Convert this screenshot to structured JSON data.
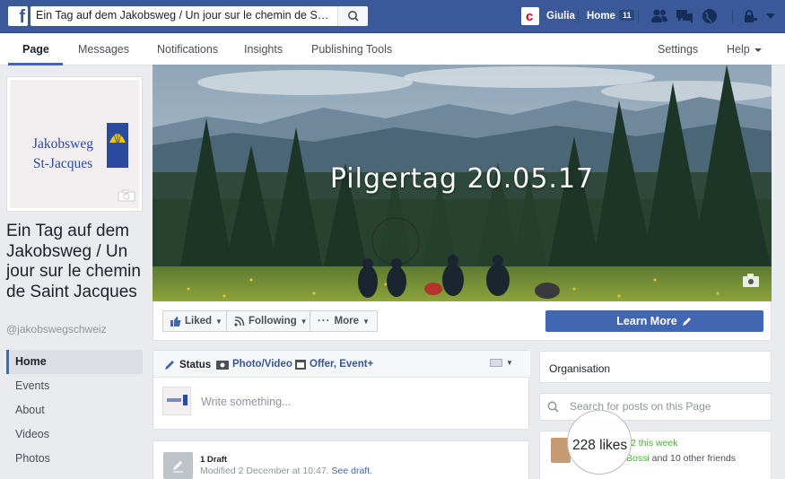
{
  "topbar": {
    "search_value": "Ein Tag auf dem Jakobsweg  / Un jour sur le chemin de Saint Jacques",
    "user_name": "Giulia",
    "home_label": "Home",
    "home_count": "11"
  },
  "pagenav": {
    "items": [
      "Page",
      "Messages",
      "Notifications",
      "Insights",
      "Publishing Tools"
    ],
    "settings": "Settings",
    "help": "Help"
  },
  "page": {
    "logo_line1": "Jakobsweg",
    "logo_line2": "St-Jacques",
    "name": "Ein Tag auf dem Jakobsweg / Un jour sur le chemin de Saint Jacques",
    "handle": "@jakobswegschweiz",
    "sidebar": [
      "Home",
      "Events",
      "About",
      "Videos",
      "Photos"
    ]
  },
  "cover": {
    "title": "Pilgertag 20.05.17",
    "liked": "Liked",
    "following": "Following",
    "more": "More",
    "learn_more": "Learn More"
  },
  "composer": {
    "status": "Status",
    "photo_video": "Photo/Video",
    "offer_event": "Offer, Event+",
    "placeholder": "Write something..."
  },
  "draft": {
    "title": "1 Draft",
    "modified": "Modified 2 December at 10:47.",
    "see_draft": "See draft."
  },
  "right": {
    "organisation": "Organisation",
    "search_placeholder": "Search for posts on this Page",
    "likes": "228 likes",
    "likes_week": "2 this week",
    "friend_name": "Bossi",
    "friends_rest": " and 10 other friends"
  },
  "colors": {
    "fb_blue": "#3b5998",
    "button_blue": "#4267b2",
    "green": "#42b72a"
  }
}
